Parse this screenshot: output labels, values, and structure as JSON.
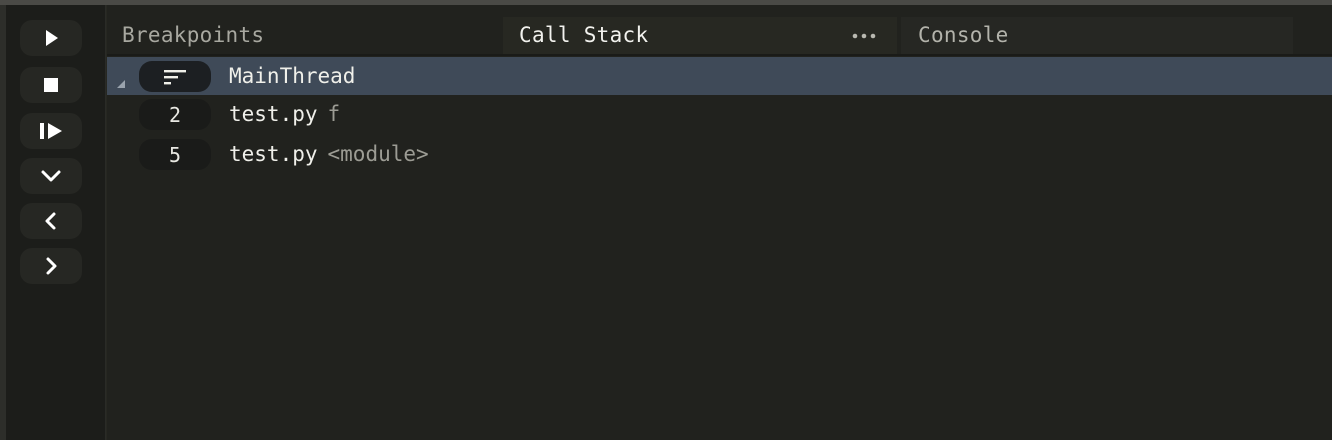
{
  "toolbar": {
    "buttons": [
      {
        "name": "continue-button",
        "icon": "play-icon"
      },
      {
        "name": "stop-button",
        "icon": "stop-icon"
      },
      {
        "name": "pause-button",
        "icon": "step-play-icon"
      },
      {
        "name": "step-over-button",
        "icon": "chevron-down-icon"
      },
      {
        "name": "step-out-button",
        "icon": "chevron-left-icon"
      },
      {
        "name": "step-into-button",
        "icon": "chevron-right-icon"
      }
    ]
  },
  "tabs": {
    "breakpoints": "Breakpoints",
    "call_stack": "Call Stack",
    "console": "Console",
    "more_icon": "ellipsis-icon"
  },
  "call_stack": {
    "thread": {
      "name": "MainThread",
      "icon": "thread-lines-icon",
      "expanded": true
    },
    "frames": [
      {
        "line": "2",
        "file": "test.py",
        "function": "f"
      },
      {
        "line": "5",
        "file": "test.py",
        "function": "<module>"
      }
    ]
  },
  "colors": {
    "selected_row": "#3f4a58",
    "active_tab": "#272822",
    "text_primary": "#f0f0ea",
    "text_muted": "#9c9c94"
  }
}
